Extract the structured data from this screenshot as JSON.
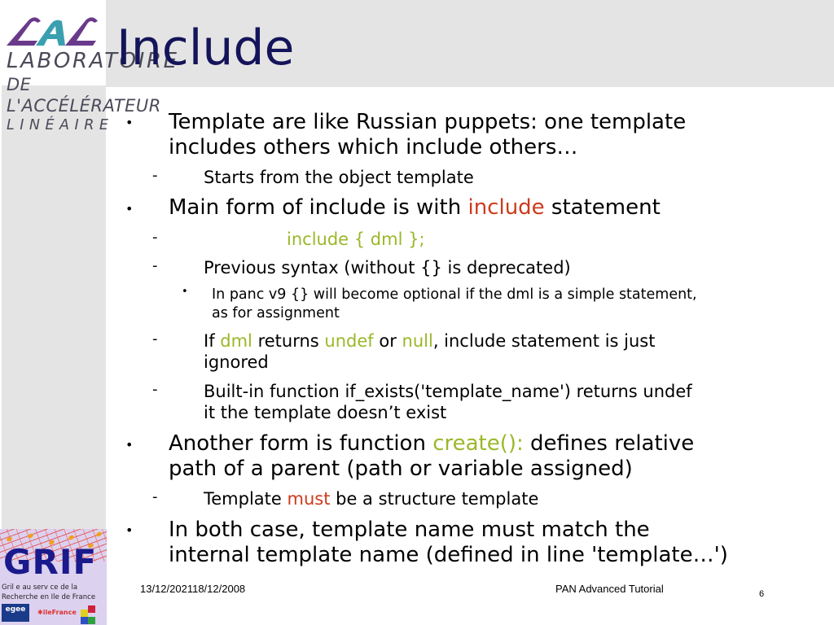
{
  "header": {
    "title": "Include",
    "logo": {
      "name": "LAL",
      "lines": [
        "LABORATOIRE",
        "DE L'ACCÉLÉRATEUR",
        "LINÉAIRE"
      ]
    }
  },
  "sidebar": {
    "logo": {
      "word": "GRIF",
      "subtitle_lines": [
        "Gril e au serv ce de la",
        "Recherche en Ile de France"
      ],
      "partner_left": "egee",
      "partner_mid": "✱ileFrance"
    }
  },
  "colors": {
    "title": "#14145a",
    "keyword_red": "#cc3b1c",
    "keyword_green": "#9ab82a",
    "band_gray": "#e4e4e4"
  },
  "body": {
    "items": [
      {
        "level": 1,
        "marker": "•",
        "lines": [
          "Template are like Russian puppets: one template",
          "includes others which include others…"
        ]
      },
      {
        "level": 2,
        "marker": "-",
        "lines": [
          "Starts from the object template"
        ]
      },
      {
        "level": 1,
        "marker": "•",
        "parts": [
          {
            "text": "Main form of include is with "
          },
          {
            "text": "include",
            "color": "red"
          },
          {
            "text": " statement"
          }
        ]
      },
      {
        "level": 2,
        "marker": "-",
        "parts": [
          {
            "text": "include { dml };",
            "color": "green"
          }
        ]
      },
      {
        "level": 2,
        "marker": "-",
        "lines": [
          "Previous syntax (without {} is deprecated)"
        ]
      },
      {
        "level": 3,
        "marker": "•",
        "lines": [
          "In panc v9 {} will become optional if the dml is a simple statement,",
          "as for assignment"
        ]
      },
      {
        "level": 2,
        "marker": "-",
        "parts": [
          {
            "text": "If "
          },
          {
            "text": "dml",
            "color": "green"
          },
          {
            "text": " returns "
          },
          {
            "text": "undef",
            "color": "green"
          },
          {
            "text": " or "
          },
          {
            "text": "null",
            "color": "green"
          },
          {
            "text": ", include statement is just"
          }
        ],
        "line2": "ignored"
      },
      {
        "level": 2,
        "marker": "-",
        "lines": [
          "Built-in function if_exists('template_name') returns undef",
          "it the template doesn’t exist"
        ]
      },
      {
        "level": 1,
        "marker": "•",
        "parts": [
          {
            "text": "Another form is function "
          },
          {
            "text": "create():",
            "color": "green"
          },
          {
            "text": " defines relative"
          }
        ],
        "line2": "path of a parent (path or variable assigned)"
      },
      {
        "level": 2,
        "marker": "-",
        "parts": [
          {
            "text": "Template "
          },
          {
            "text": "must",
            "color": "red"
          },
          {
            "text": " be a structure template"
          }
        ]
      },
      {
        "level": 1,
        "marker": "•",
        "lines": [
          "In both case, template name must match the",
          "internal template name (defined in line 'template…')"
        ]
      }
    ]
  },
  "footer": {
    "date": "13/12/202118/12/2008",
    "center": "PAN Advanced Tutorial",
    "page_number": "6"
  }
}
